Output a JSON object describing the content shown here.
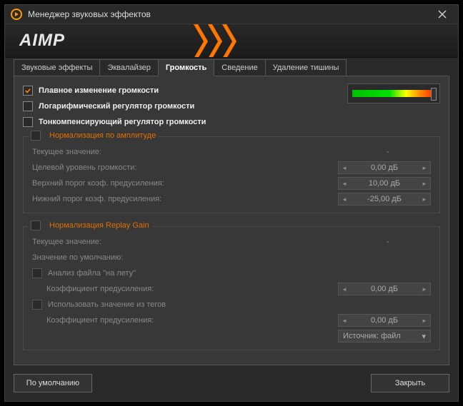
{
  "title": "Менеджер звуковых эффектов",
  "logo": "AIMP",
  "tabs": [
    "Звуковые эффекты",
    "Эквалайзер",
    "Громкость",
    "Сведение",
    "Удаление тишины"
  ],
  "checks": {
    "smooth": "Плавное изменение громкости",
    "log": "Логарифмический регулятор громкости",
    "comp": "Тонкомпенсирующий регулятор громкости"
  },
  "amp": {
    "title": "Нормализация по амплитуде",
    "current_label": "Текущее значение:",
    "current_value": "-",
    "target_label": "Целевой уровень громкости:",
    "target_value": "0,00 дБ",
    "upper_label": "Верхний порог коэф. предусиления:",
    "upper_value": "10,00 дБ",
    "lower_label": "Нижний порог коэф. предусиления:",
    "lower_value": "-25,00 дБ"
  },
  "rg": {
    "title": "Нормализация Replay Gain",
    "current_label": "Текущее значение:",
    "current_value": "-",
    "default_label": "Значение по умолчанию:",
    "onfly": "Анализ файла \"на лету\"",
    "preamp1_label": "Коэффициент предусиления:",
    "preamp1_value": "0,00 дБ",
    "tags": "Использовать значение из тегов",
    "preamp2_label": "Коэффициент предусиления:",
    "preamp2_value": "0,00 дБ",
    "source": "Источник: файл"
  },
  "buttons": {
    "default": "По умолчанию",
    "close": "Закрыть"
  }
}
